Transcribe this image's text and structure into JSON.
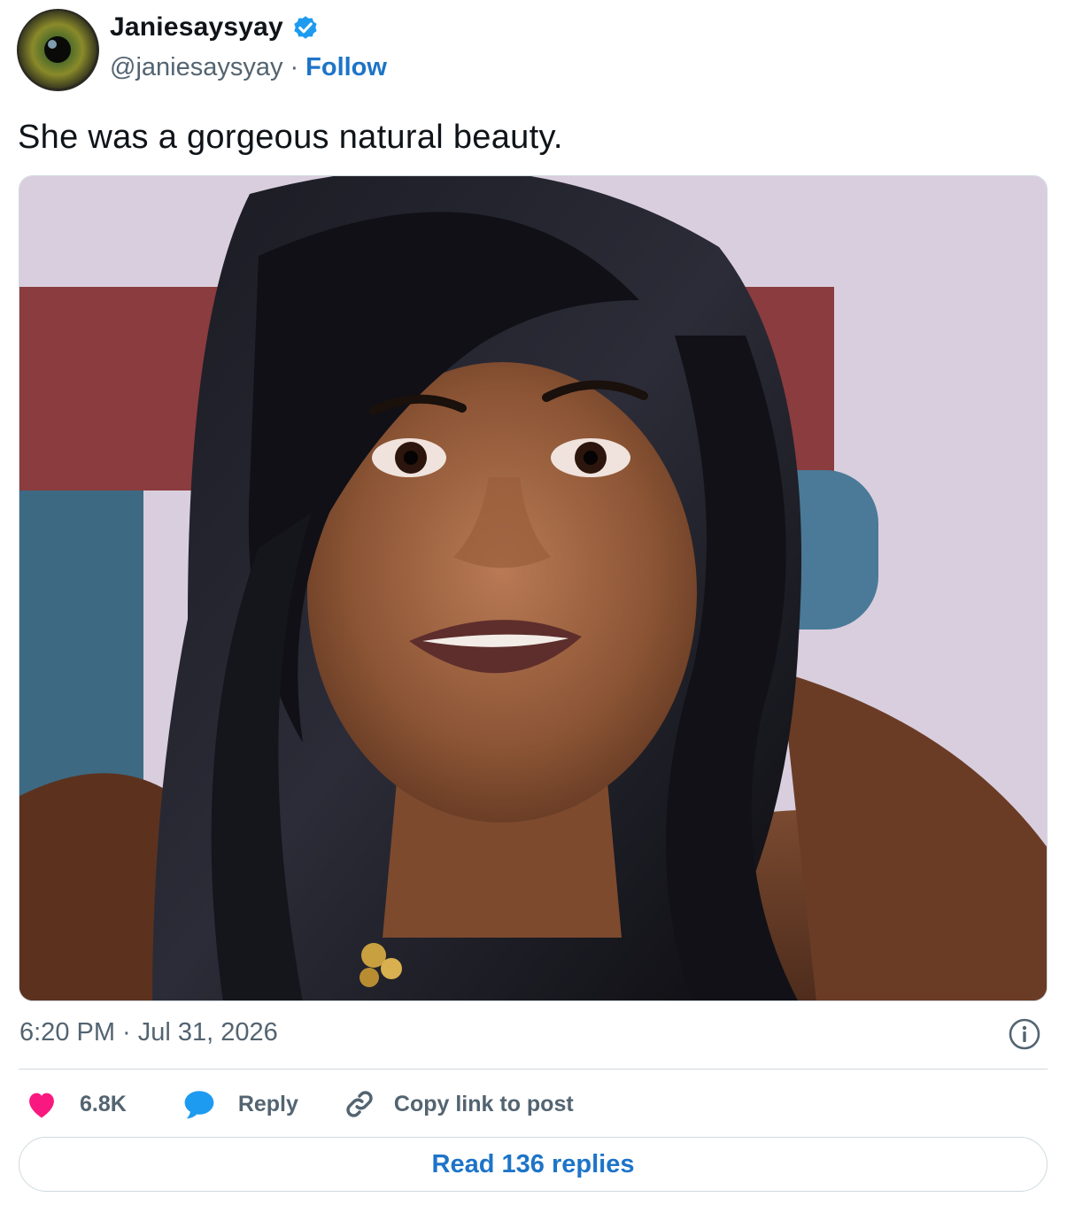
{
  "author": {
    "display_name": "Janiesaysyay",
    "handle": "@janiesaysyay",
    "separator": "·",
    "follow_label": "Follow",
    "verified": true
  },
  "tweet": {
    "text": "She was a gorgeous natural beauty.",
    "media": {
      "description_icon": "photo"
    },
    "timestamp": "6:20 PM · Jul 31, 2026"
  },
  "actions": {
    "likes_count": "6.8K",
    "reply_label": "Reply",
    "copy_link_label": "Copy link to post"
  },
  "footer": {
    "read_replies_label": "Read 136 replies"
  },
  "colors": {
    "accent_blue": "#1d74c8",
    "verified_blue": "#1d9bf0",
    "like_pink": "#f91880",
    "reply_blue": "#1d9bf0",
    "muted_text": "#536471",
    "border": "#cfd9de"
  }
}
